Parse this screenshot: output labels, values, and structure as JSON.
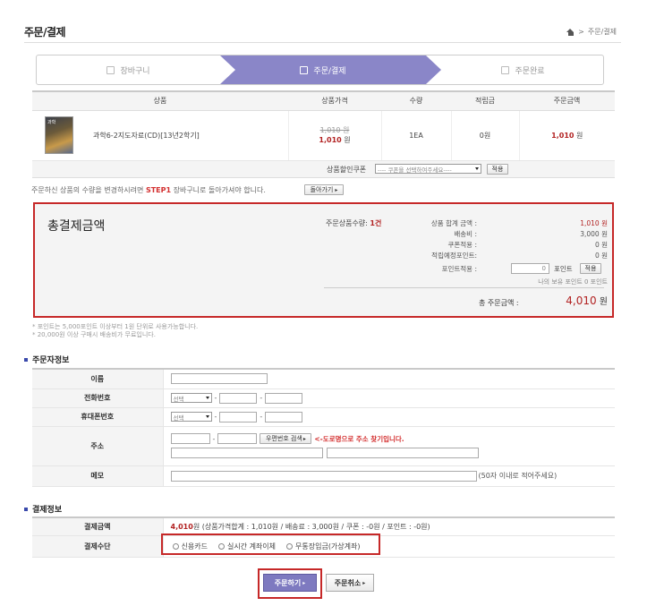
{
  "header": {
    "title": "주문/결제",
    "breadcrumb": "주문/결제"
  },
  "steps": [
    {
      "label": "장바구니"
    },
    {
      "label": "주문/결제"
    },
    {
      "label": "주문완료"
    }
  ],
  "product_table": {
    "headers": [
      "상품",
      "상품가격",
      "수량",
      "적립금",
      "주문금액"
    ],
    "rows": [
      {
        "name": "과학6-2지도자료(CD)[13년2학기]",
        "orig_price": "1,010 원",
        "price": "1,010",
        "price_unit": " 원",
        "qty": "1EA",
        "points": "0원",
        "total": "1,010",
        "total_unit": " 원"
      }
    ]
  },
  "coupon": {
    "label": "상품할인쿠폰",
    "placeholder": "---- 쿠폰을 선택하여주세요----",
    "apply": "적용"
  },
  "notice": {
    "before": "주문하신 상품의 수량을 변경하시려면 ",
    "highlight": "STEP1",
    "after": " 장바구니로 돌아가셔야 합니다.",
    "back_button": "돌아가기"
  },
  "summary": {
    "title": "총결제금액",
    "qty_label": "주문상품수량:",
    "qty_value": "1건",
    "items": [
      {
        "label": "상품 합계 금액 :",
        "value": "1,010 원"
      },
      {
        "label": "배송비 :",
        "value": "3,000 원"
      },
      {
        "label": "쿠폰적용 :",
        "value": "0 원"
      },
      {
        "label": "적립예정포인트:",
        "value": "0 원"
      }
    ],
    "point_label": "포인트적용 :",
    "point_input": "0",
    "point_unit": "포인트",
    "point_apply": "적용",
    "my_point": "나의 보유 포인트 0 포인트",
    "grand_label": "총 주문금액 :",
    "grand_value": "4,010",
    "grand_unit": " 원"
  },
  "notes": [
    "* 포인트는 5,000포인트 이상부터 1원 단위로 사용가능합니다.",
    "* 20,000원 이상 구매시 배송비가 무료입니다."
  ],
  "orderer": {
    "section_title": "주문자정보",
    "name_label": "이름",
    "phone_label": "전화번호",
    "phone_select": "선택",
    "mobile_label": "휴대폰번호",
    "mobile_select": "선택",
    "address_label": "주소",
    "zip_button": "우편번호 검색",
    "zip_hint": "<-도로명으로 주소 찾기입니다.",
    "memo_label": "메모",
    "memo_hint": "(50자 이내로 적어주세요)"
  },
  "payment": {
    "section_title": "결제정보",
    "amount_label": "결제금액",
    "amount_value": "4,010",
    "amount_detail": "원 (상품가격합계 : 1,010원 / 배송료 : 3,000원 / 쿠폰 : -0원 / 포인트 : -0원)",
    "method_label": "결제수단",
    "methods": [
      "신용카드",
      "실시간 계좌이체",
      "무통장입금(가상계좌)"
    ]
  },
  "actions": {
    "order": "주문하기",
    "cancel": "주문취소"
  }
}
